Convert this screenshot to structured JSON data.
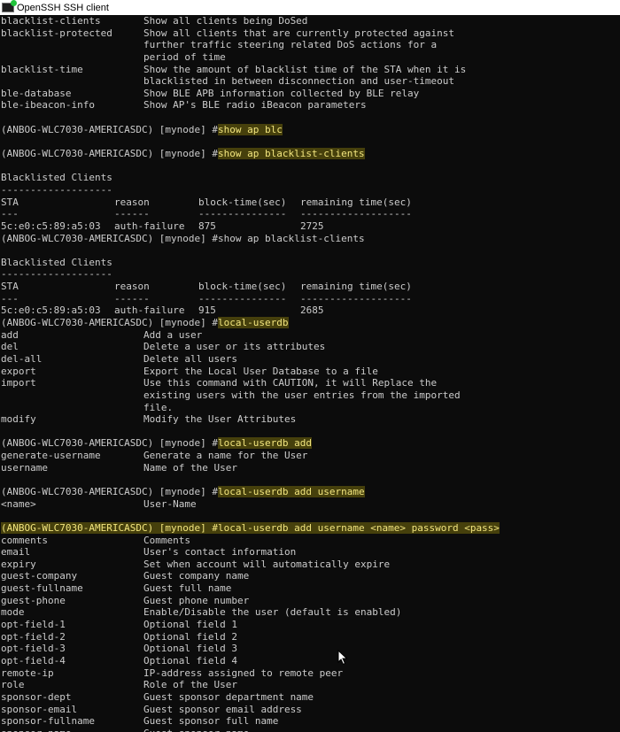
{
  "window": {
    "title": "OpenSSH SSH client"
  },
  "prompt": "(ANBOG-WLC7030-AMERICASDC) [mynode] #",
  "terminal": {
    "help1": [
      [
        "blacklist-clients",
        "Show all clients being DoSed"
      ],
      [
        "blacklist-protected",
        "Show all clients that are currently protected against"
      ],
      [
        "",
        "further traffic steering related DoS actions for a"
      ],
      [
        "",
        "period of time"
      ],
      [
        "blacklist-time",
        "Show the amount of blacklist time of the STA when it is"
      ],
      [
        "",
        "blacklisted in between disconnection and user-timeout"
      ],
      [
        "ble-database",
        "Show BLE APB information collected by BLE relay"
      ],
      [
        "ble-ibeacon-info",
        "Show AP's BLE radio iBeacon parameters"
      ]
    ],
    "cmd1": "show ap blc",
    "cmd2": "show ap blacklist-clients",
    "blacklist_title": "Blacklisted Clients",
    "blacklist_rule": "-------------------",
    "table_headers": [
      "STA",
      "reason",
      "block-time(sec)",
      "remaining time(sec)"
    ],
    "table_dashes": [
      "---",
      "------",
      "---------------",
      "-------------------"
    ],
    "table1_row": [
      "5c:e0:c5:89:a5:03",
      "auth-failure",
      "875",
      "2725"
    ],
    "cmd3": "show ap blacklist-clients",
    "table2_row": [
      "5c:e0:c5:89:a5:03",
      "auth-failure",
      "915",
      "2685"
    ],
    "cmd4": "local-userdb",
    "help2": [
      [
        "add",
        "Add a user"
      ],
      [
        "del",
        "Delete a user or its attributes"
      ],
      [
        "del-all",
        "Delete all users"
      ],
      [
        "export",
        "Export the Local User Database to a file"
      ],
      [
        "import",
        "Use this command with CAUTION, it will Replace the"
      ],
      [
        "",
        "existing users with the user entries from the imported"
      ],
      [
        "",
        "file."
      ],
      [
        "modify",
        "Modify the User Attributes"
      ]
    ],
    "cmd5": "local-userdb add",
    "help3": [
      [
        "generate-username",
        "Generate a name for the User"
      ],
      [
        "username",
        "Name of the User"
      ]
    ],
    "cmd6": "local-userdb add username",
    "help4": [
      [
        "<name>",
        "User-Name"
      ]
    ],
    "cmd7": "local-userdb add username <name> password <pass>",
    "help5": [
      [
        "comments",
        "Comments"
      ],
      [
        "email",
        "User's contact information"
      ],
      [
        "expiry",
        "Set when account will automatically expire"
      ],
      [
        "guest-company",
        "Guest company name"
      ],
      [
        "guest-fullname",
        "Guest full name"
      ],
      [
        "guest-phone",
        "Guest phone number"
      ],
      [
        "mode",
        "Enable/Disable the user (default is enabled)"
      ],
      [
        "opt-field-1",
        "Optional field 1"
      ],
      [
        "opt-field-2",
        "Optional field 2"
      ],
      [
        "opt-field-3",
        "Optional field 3"
      ],
      [
        "opt-field-4",
        "Optional field 4"
      ],
      [
        "remote-ip",
        "IP-address assigned to remote peer"
      ],
      [
        "role",
        "Role of the User"
      ],
      [
        "sponsor-dept",
        "Guest sponsor department name"
      ],
      [
        "sponsor-email",
        "Guest sponsor email address"
      ],
      [
        "sponsor-fullname",
        "Guest sponsor full name"
      ],
      [
        "sponsor-name",
        "Guest sponsor name"
      ]
    ]
  },
  "colors": {
    "background": "#0c0c0c",
    "text": "#cccccc",
    "highlight_bg": "#46400c",
    "highlight_text": "#f2e57e"
  }
}
